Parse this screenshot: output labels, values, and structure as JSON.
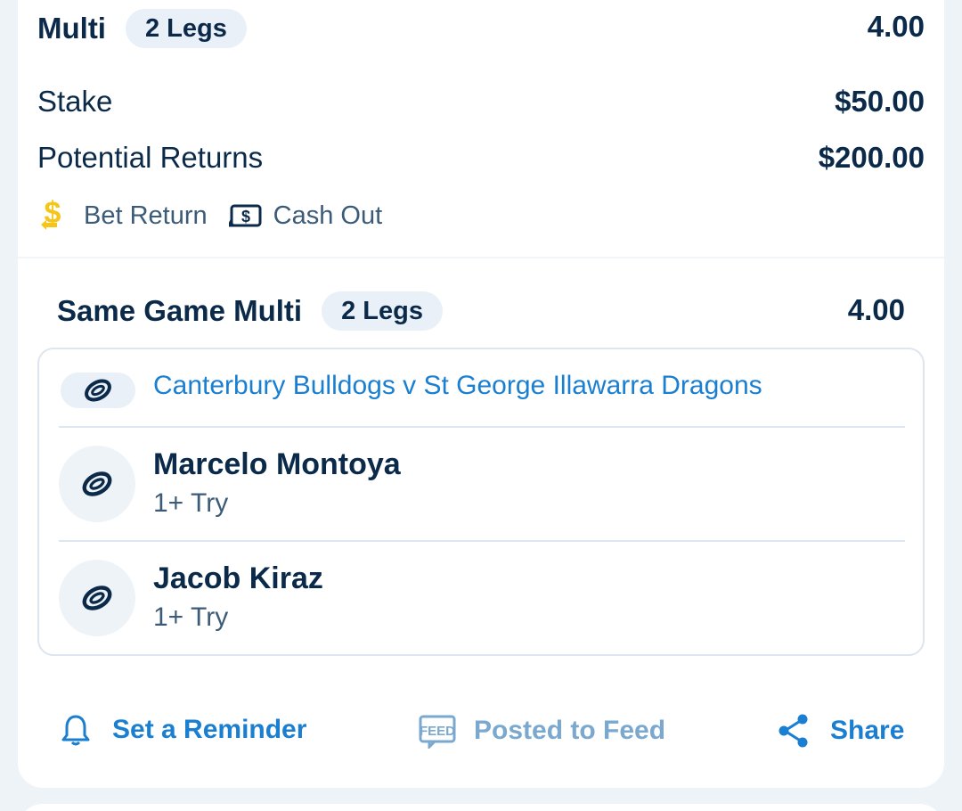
{
  "multi": {
    "title": "Multi",
    "legs_badge": "2 Legs",
    "odds": "4.00"
  },
  "stake": {
    "label": "Stake",
    "value": "$50.00"
  },
  "returns": {
    "label": "Potential Returns",
    "value": "$200.00"
  },
  "features": {
    "bet_return": "Bet Return",
    "cash_out": "Cash Out"
  },
  "sgm": {
    "title": "Same Game Multi",
    "legs_badge": "2 Legs",
    "odds": "4.00",
    "match": "Canterbury Bulldogs v St George Illawarra Dragons",
    "legs": [
      {
        "player": "Marcelo Montoya",
        "market": "1+ Try"
      },
      {
        "player": "Jacob Kiraz",
        "market": "1+ Try"
      }
    ]
  },
  "actions": {
    "reminder": "Set a Reminder",
    "feed": "Posted to Feed",
    "share": "Share"
  },
  "colors": {
    "navy": "#0b2a4a",
    "link_blue": "#1a7fd0",
    "muted_blue": "#7aa8cf",
    "gold": "#f5c518",
    "page_bg": "#eef3f8"
  },
  "icons": [
    "dollar-return-icon",
    "cash-out-icon",
    "rugby-ball-icon",
    "bell-icon",
    "feed-icon",
    "share-icon"
  ]
}
